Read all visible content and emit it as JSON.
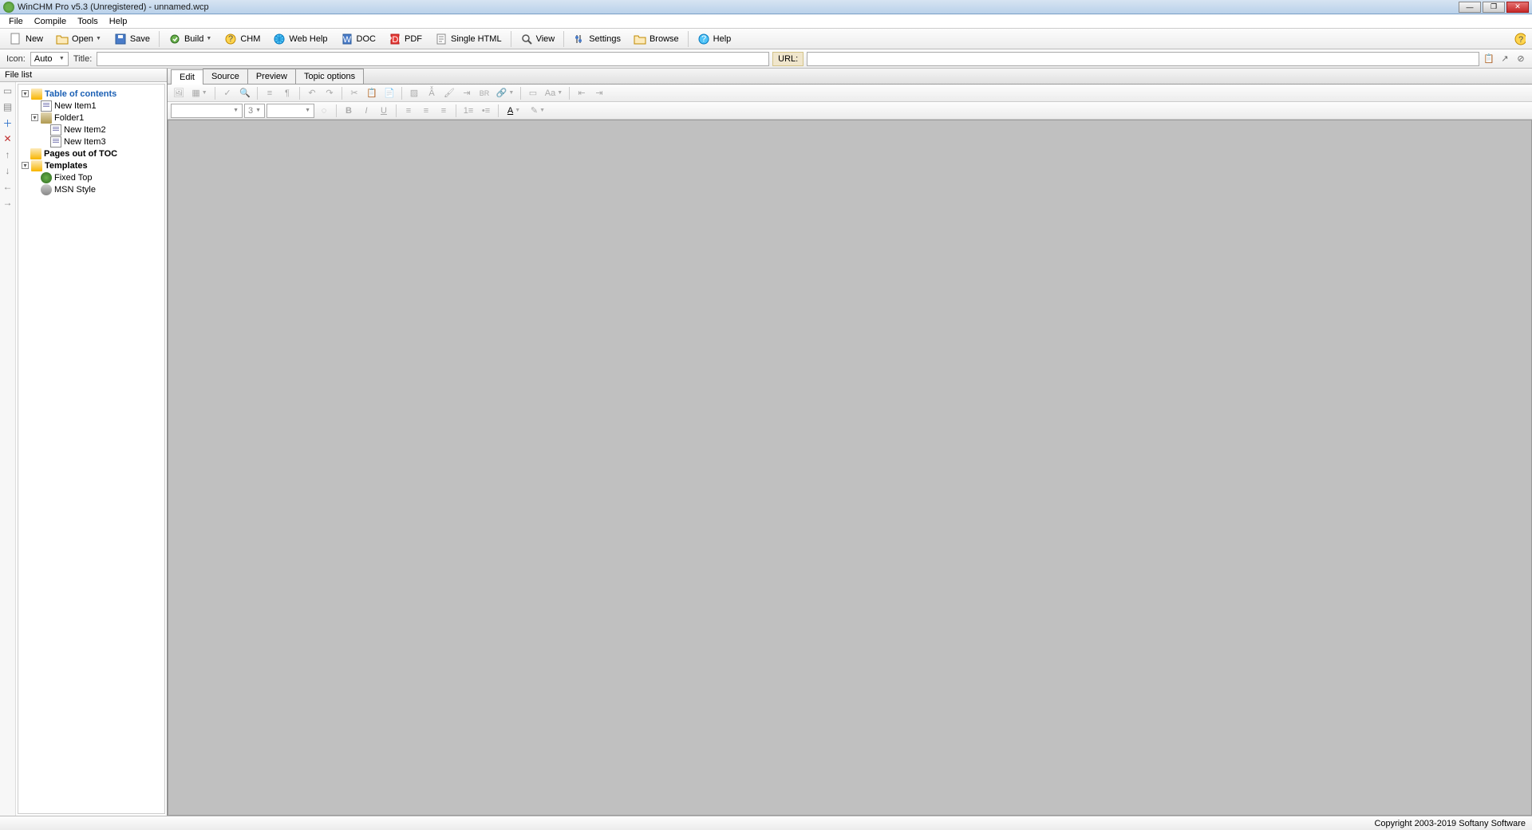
{
  "titlebar": {
    "title": "WinCHM Pro v5.3 (Unregistered) - unnamed.wcp"
  },
  "menu": {
    "items": [
      "File",
      "Compile",
      "Tools",
      "Help"
    ]
  },
  "toolbar": {
    "new": "New",
    "open": "Open",
    "save": "Save",
    "build": "Build",
    "chm": "CHM",
    "webhelp": "Web Help",
    "doc": "DOC",
    "pdf": "PDF",
    "singlehtml": "Single HTML",
    "view": "View",
    "settings": "Settings",
    "browse": "Browse",
    "help": "Help"
  },
  "toolbar2": {
    "icon_label": "Icon:",
    "icon_value": "Auto",
    "title_label": "Title:",
    "title_value": "",
    "url_label": "URL:",
    "url_value": ""
  },
  "sidebar": {
    "header": "File list",
    "tree": {
      "toc": "Table of contents",
      "item1": "New Item1",
      "folder1": "Folder1",
      "item2": "New Item2",
      "item3": "New Item3",
      "pages_out": "Pages out of TOC",
      "templates": "Templates",
      "tpl1": "Fixed Top",
      "tpl2": "MSN Style"
    }
  },
  "tabs": {
    "edit": "Edit",
    "source": "Source",
    "preview": "Preview",
    "topic": "Topic options"
  },
  "editor": {
    "font_size": "3",
    "br_label": "BR"
  },
  "statusbar": {
    "copyright": "Copyright 2003-2019 Softany Software"
  }
}
